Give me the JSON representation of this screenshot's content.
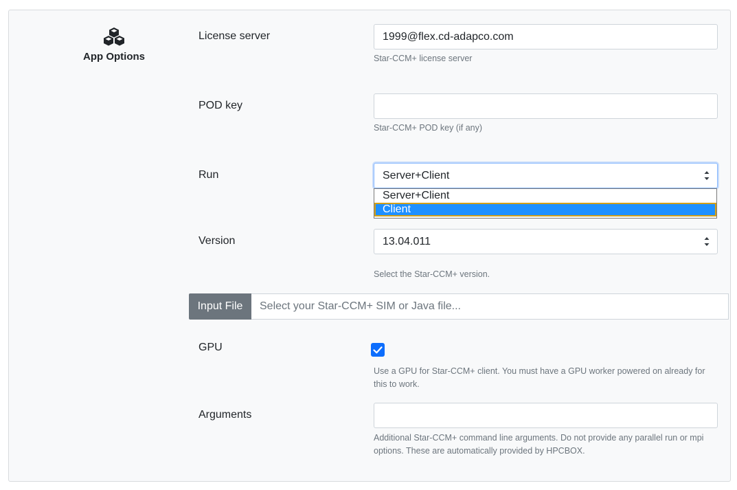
{
  "section": {
    "title": "App Options",
    "icon": "cubes-icon"
  },
  "license_server": {
    "label": "License server",
    "value": "1999@flex.cd-adapco.com",
    "help": "Star-CCM+ license server"
  },
  "pod_key": {
    "label": "POD key",
    "value": "",
    "help": "Star-CCM+ POD key (if any)"
  },
  "run": {
    "label": "Run",
    "selected": "Server+Client",
    "options": [
      "Server+Client",
      "Client"
    ],
    "highlighted": "Client"
  },
  "version": {
    "label": "Version",
    "selected": "13.04.011",
    "help": "Select the Star-CCM+ version."
  },
  "input_file": {
    "button_label": "Input File",
    "placeholder": "Select your Star-CCM+ SIM or Java file..."
  },
  "gpu": {
    "label": "GPU",
    "checked": true,
    "help": "Use a GPU for Star-CCM+ client. You must have a GPU worker powered on already for this to work."
  },
  "arguments": {
    "label": "Arguments",
    "value": "",
    "help": "Additional Star-CCM+ command line arguments. Do not provide any parallel run or mpi options. These are automatically provided by HPCBOX."
  },
  "colors": {
    "accent": "#0d6efd",
    "highlight": "#1e90ff",
    "file_button": "#6c757d"
  }
}
